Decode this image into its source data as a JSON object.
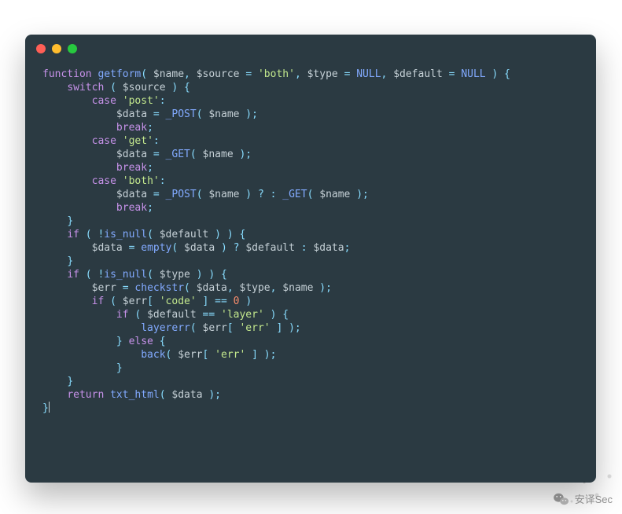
{
  "code": {
    "tokens": [
      [
        [
          "kw",
          "function"
        ],
        [
          "id",
          " "
        ],
        [
          "fn",
          "getform"
        ],
        [
          "op",
          "( "
        ],
        [
          "var",
          "$name"
        ],
        [
          "op",
          ", "
        ],
        [
          "var",
          "$source"
        ],
        [
          "op",
          " = "
        ],
        [
          "str",
          "'both'"
        ],
        [
          "op",
          ", "
        ],
        [
          "var",
          "$type"
        ],
        [
          "op",
          " = "
        ],
        [
          "null",
          "NULL"
        ],
        [
          "op",
          ", "
        ],
        [
          "var",
          "$default"
        ],
        [
          "op",
          " = "
        ],
        [
          "null",
          "NULL"
        ],
        [
          "op",
          " ) {"
        ]
      ],
      [
        [
          "id",
          "    "
        ],
        [
          "kw",
          "switch"
        ],
        [
          "op",
          " ( "
        ],
        [
          "var",
          "$source"
        ],
        [
          "op",
          " ) {"
        ]
      ],
      [
        [
          "id",
          "        "
        ],
        [
          "kw",
          "case"
        ],
        [
          "id",
          " "
        ],
        [
          "str",
          "'post'"
        ],
        [
          "op",
          ":"
        ]
      ],
      [
        [
          "id",
          "            "
        ],
        [
          "var",
          "$data"
        ],
        [
          "op",
          " = "
        ],
        [
          "fn",
          "_POST"
        ],
        [
          "op",
          "( "
        ],
        [
          "var",
          "$name"
        ],
        [
          "op",
          " );"
        ]
      ],
      [
        [
          "id",
          "            "
        ],
        [
          "kw",
          "break"
        ],
        [
          "op",
          ";"
        ]
      ],
      [
        [
          "id",
          "        "
        ],
        [
          "kw",
          "case"
        ],
        [
          "id",
          " "
        ],
        [
          "str",
          "'get'"
        ],
        [
          "op",
          ":"
        ]
      ],
      [
        [
          "id",
          "            "
        ],
        [
          "var",
          "$data"
        ],
        [
          "op",
          " = "
        ],
        [
          "fn",
          "_GET"
        ],
        [
          "op",
          "( "
        ],
        [
          "var",
          "$name"
        ],
        [
          "op",
          " );"
        ]
      ],
      [
        [
          "id",
          "            "
        ],
        [
          "kw",
          "break"
        ],
        [
          "op",
          ";"
        ]
      ],
      [
        [
          "id",
          "        "
        ],
        [
          "kw",
          "case"
        ],
        [
          "id",
          " "
        ],
        [
          "str",
          "'both'"
        ],
        [
          "op",
          ":"
        ]
      ],
      [
        [
          "id",
          "            "
        ],
        [
          "var",
          "$data"
        ],
        [
          "op",
          " = "
        ],
        [
          "fn",
          "_POST"
        ],
        [
          "op",
          "( "
        ],
        [
          "var",
          "$name"
        ],
        [
          "op",
          " ) ? : "
        ],
        [
          "fn",
          "_GET"
        ],
        [
          "op",
          "( "
        ],
        [
          "var",
          "$name"
        ],
        [
          "op",
          " );"
        ]
      ],
      [
        [
          "id",
          "            "
        ],
        [
          "kw",
          "break"
        ],
        [
          "op",
          ";"
        ]
      ],
      [
        [
          "id",
          "    "
        ],
        [
          "op",
          "}"
        ]
      ],
      [
        [
          "id",
          "    "
        ],
        [
          "kw",
          "if"
        ],
        [
          "op",
          " ( "
        ],
        [
          "op",
          "!"
        ],
        [
          "fn",
          "is_null"
        ],
        [
          "op",
          "( "
        ],
        [
          "var",
          "$default"
        ],
        [
          "op",
          " ) ) {"
        ]
      ],
      [
        [
          "id",
          "        "
        ],
        [
          "var",
          "$data"
        ],
        [
          "op",
          " = "
        ],
        [
          "fn",
          "empty"
        ],
        [
          "op",
          "( "
        ],
        [
          "var",
          "$data"
        ],
        [
          "op",
          " ) ? "
        ],
        [
          "var",
          "$default"
        ],
        [
          "op",
          " : "
        ],
        [
          "var",
          "$data"
        ],
        [
          "op",
          ";"
        ]
      ],
      [
        [
          "id",
          "    "
        ],
        [
          "op",
          "}"
        ]
      ],
      [
        [
          "id",
          "    "
        ],
        [
          "kw",
          "if"
        ],
        [
          "op",
          " ( "
        ],
        [
          "op",
          "!"
        ],
        [
          "fn",
          "is_null"
        ],
        [
          "op",
          "( "
        ],
        [
          "var",
          "$type"
        ],
        [
          "op",
          " ) ) {"
        ]
      ],
      [
        [
          "id",
          "        "
        ],
        [
          "var",
          "$err"
        ],
        [
          "op",
          " = "
        ],
        [
          "fn",
          "checkstr"
        ],
        [
          "op",
          "( "
        ],
        [
          "var",
          "$data"
        ],
        [
          "op",
          ", "
        ],
        [
          "var",
          "$type"
        ],
        [
          "op",
          ", "
        ],
        [
          "var",
          "$name"
        ],
        [
          "op",
          " );"
        ]
      ],
      [
        [
          "id",
          "        "
        ],
        [
          "kw",
          "if"
        ],
        [
          "op",
          " ( "
        ],
        [
          "var",
          "$err"
        ],
        [
          "op",
          "[ "
        ],
        [
          "str",
          "'code'"
        ],
        [
          "op",
          " ] == "
        ],
        [
          "num",
          "0"
        ],
        [
          "op",
          " )"
        ]
      ],
      [
        [
          "id",
          "            "
        ],
        [
          "kw",
          "if"
        ],
        [
          "op",
          " ( "
        ],
        [
          "var",
          "$default"
        ],
        [
          "op",
          " == "
        ],
        [
          "str",
          "'layer'"
        ],
        [
          "op",
          " ) {"
        ]
      ],
      [
        [
          "id",
          "                "
        ],
        [
          "fn",
          "layererr"
        ],
        [
          "op",
          "( "
        ],
        [
          "var",
          "$err"
        ],
        [
          "op",
          "[ "
        ],
        [
          "str",
          "'err'"
        ],
        [
          "op",
          " ] );"
        ]
      ],
      [
        [
          "id",
          "            "
        ],
        [
          "op",
          "} "
        ],
        [
          "kw",
          "else"
        ],
        [
          "op",
          " {"
        ]
      ],
      [
        [
          "id",
          "                "
        ],
        [
          "fn",
          "back"
        ],
        [
          "op",
          "( "
        ],
        [
          "var",
          "$err"
        ],
        [
          "op",
          "[ "
        ],
        [
          "str",
          "'err'"
        ],
        [
          "op",
          " ] );"
        ]
      ],
      [
        [
          "id",
          "            "
        ],
        [
          "op",
          "}"
        ]
      ],
      [
        [
          "id",
          "    "
        ],
        [
          "op",
          "}"
        ]
      ],
      [
        [
          "id",
          "    "
        ],
        [
          "kw",
          "return"
        ],
        [
          "id",
          " "
        ],
        [
          "fn",
          "txt_html"
        ],
        [
          "op",
          "( "
        ],
        [
          "var",
          "$data"
        ],
        [
          "op",
          " );"
        ]
      ],
      [
        [
          "op",
          "}"
        ]
      ]
    ]
  },
  "watermark": {
    "text": "安译Sec"
  }
}
